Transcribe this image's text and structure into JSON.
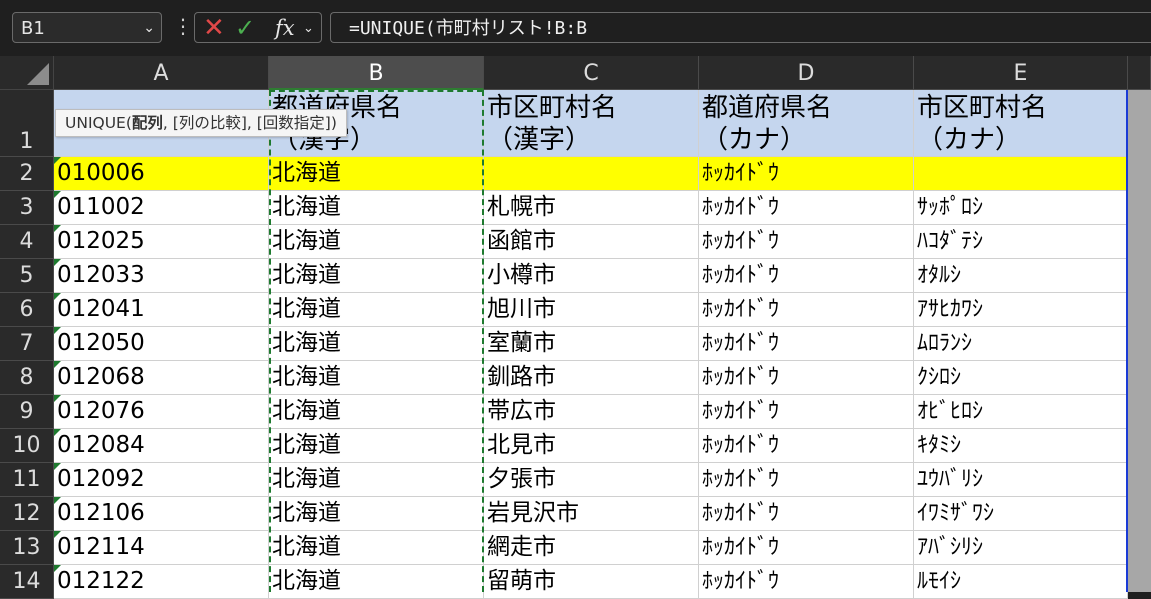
{
  "formula_bar": {
    "name_box": "B1",
    "formula": "=UNIQUE(市町村リスト!B:B",
    "fx_label": "fx"
  },
  "tooltip": {
    "fn": "UNIQUE(",
    "arg1": "配列",
    "rest": ", [列の比較], [回数指定])"
  },
  "columns": [
    "A",
    "B",
    "C",
    "D",
    "E"
  ],
  "selected_column": "B",
  "header_row": {
    "row": "1",
    "cells": [
      "",
      "都道府県名\n（漢字）",
      "市区町村名\n（漢字）",
      "都道府県名\n（カナ）",
      "市区町村名\n（カナ）"
    ]
  },
  "rows": [
    {
      "row": "2",
      "cells": [
        "010006",
        "北海道",
        "",
        "ﾎｯｶｲﾄﾞｳ",
        ""
      ]
    },
    {
      "row": "3",
      "cells": [
        "011002",
        "北海道",
        "札幌市",
        "ﾎｯｶｲﾄﾞｳ",
        "ｻｯﾎﾟﾛｼ"
      ]
    },
    {
      "row": "4",
      "cells": [
        "012025",
        "北海道",
        "函館市",
        "ﾎｯｶｲﾄﾞｳ",
        "ﾊｺﾀﾞﾃｼ"
      ]
    },
    {
      "row": "5",
      "cells": [
        "012033",
        "北海道",
        "小樽市",
        "ﾎｯｶｲﾄﾞｳ",
        "ｵﾀﾙｼ"
      ]
    },
    {
      "row": "6",
      "cells": [
        "012041",
        "北海道",
        "旭川市",
        "ﾎｯｶｲﾄﾞｳ",
        "ｱｻﾋｶﾜｼ"
      ]
    },
    {
      "row": "7",
      "cells": [
        "012050",
        "北海道",
        "室蘭市",
        "ﾎｯｶｲﾄﾞｳ",
        "ﾑﾛﾗﾝｼ"
      ]
    },
    {
      "row": "8",
      "cells": [
        "012068",
        "北海道",
        "釧路市",
        "ﾎｯｶｲﾄﾞｳ",
        "ｸｼﾛｼ"
      ]
    },
    {
      "row": "9",
      "cells": [
        "012076",
        "北海道",
        "帯広市",
        "ﾎｯｶｲﾄﾞｳ",
        "ｵﾋﾞﾋﾛｼ"
      ]
    },
    {
      "row": "10",
      "cells": [
        "012084",
        "北海道",
        "北見市",
        "ﾎｯｶｲﾄﾞｳ",
        "ｷﾀﾐｼ"
      ]
    },
    {
      "row": "11",
      "cells": [
        "012092",
        "北海道",
        "夕張市",
        "ﾎｯｶｲﾄﾞｳ",
        "ﾕｳﾊﾞﾘｼ"
      ]
    },
    {
      "row": "12",
      "cells": [
        "012106",
        "北海道",
        "岩見沢市",
        "ﾎｯｶｲﾄﾞｳ",
        "ｲﾜﾐｻﾞﾜｼ"
      ]
    },
    {
      "row": "13",
      "cells": [
        "012114",
        "北海道",
        "網走市",
        "ﾎｯｶｲﾄﾞｳ",
        "ｱﾊﾞｼﾘｼ"
      ]
    },
    {
      "row": "14",
      "cells": [
        "012122",
        "北海道",
        "留萌市",
        "ﾎｯｶｲﾄﾞｳ",
        "ﾙﾓｲｼ"
      ]
    }
  ],
  "colors": {
    "header_fill": "#c5d6ee",
    "highlight_row": "#ffff00",
    "copy_marquee": "#1e7a2f",
    "range_border": "#1a3bd6"
  }
}
